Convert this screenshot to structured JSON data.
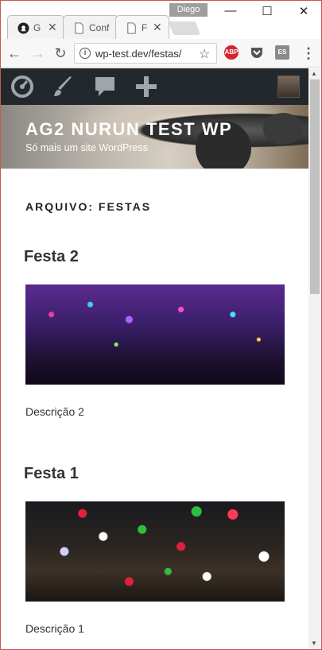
{
  "browser": {
    "profile_name": "Diego",
    "tabs": [
      {
        "title": "G",
        "icon": "github-icon"
      },
      {
        "title": "Conf",
        "icon": "page-icon"
      },
      {
        "title": "F",
        "icon": "page-icon",
        "active": true
      }
    ],
    "url": "wp-test.dev/festas/",
    "extensions": [
      {
        "name": "adblock-plus-icon",
        "label": "ABP",
        "color": "#d6232d"
      },
      {
        "name": "pocket-icon",
        "color": "#555555"
      },
      {
        "name": "extension-es-icon",
        "label": "ES",
        "color": "#8a8a8a"
      }
    ]
  },
  "adminbar": {
    "items": [
      "dashboard-icon",
      "customize-brush-icon",
      "comments-icon",
      "new-content-plus-icon"
    ]
  },
  "site": {
    "title": "AG2 NURUN TEST WP",
    "description": "Só mais um site WordPress"
  },
  "archive": {
    "title": "ARQUIVO: FESTAS"
  },
  "posts": [
    {
      "title": "Festa 2",
      "description": "Descrição 2"
    },
    {
      "title": "Festa 1",
      "description": "Descrição 1"
    }
  ]
}
